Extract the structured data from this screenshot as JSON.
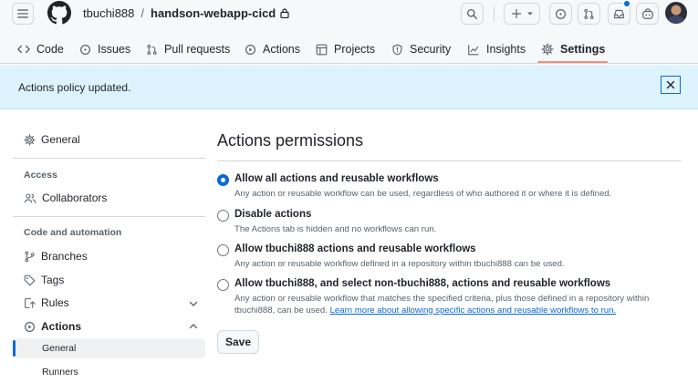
{
  "header": {
    "owner": "tbuchi888",
    "separator": "/",
    "repo": "handson-webapp-cicd",
    "icons": [
      "hamburger-icon",
      "github-logo-icon",
      "lock-icon",
      "search-icon",
      "plus-icon",
      "issue-icon",
      "pull-request-icon",
      "inbox-icon",
      "copilot-icon"
    ],
    "notification_color": "#0969da"
  },
  "tabs": [
    {
      "label": "Code",
      "icon": "code-icon"
    },
    {
      "label": "Issues",
      "icon": "issue-opened-icon"
    },
    {
      "label": "Pull requests",
      "icon": "git-pull-request-icon"
    },
    {
      "label": "Actions",
      "icon": "play-icon"
    },
    {
      "label": "Projects",
      "icon": "table-icon"
    },
    {
      "label": "Security",
      "icon": "shield-icon"
    },
    {
      "label": "Insights",
      "icon": "graph-icon"
    },
    {
      "label": "Settings",
      "icon": "gear-icon",
      "selected": true
    }
  ],
  "flash": {
    "message": "Actions policy updated."
  },
  "sidebar": {
    "general": "General",
    "access_heading": "Access",
    "collaborators": "Collaborators",
    "code_heading": "Code and automation",
    "branches": "Branches",
    "tags": "Tags",
    "rules": "Rules",
    "actions": "Actions",
    "actions_general": "General",
    "actions_runners": "Runners"
  },
  "main": {
    "title": "Actions permissions",
    "options": [
      {
        "label": "Allow all actions and reusable workflows",
        "description": "Any action or reusable workflow can be used, regardless of who authored it or where it is defined.",
        "checked": true
      },
      {
        "label": "Disable actions",
        "description": "The Actions tab is hidden and no workflows can run.",
        "checked": false
      },
      {
        "label": "Allow tbuchi888 actions and reusable workflows",
        "description": "Any action or reusable workflow defined in a repository within tbuchi888 can be used.",
        "checked": false
      },
      {
        "label": "Allow tbuchi888, and select non-tbuchi888, actions and reusable workflows",
        "description": "Any action or reusable workflow that matches the specified criteria, plus those defined in a repository within tbuchi888, can be used.",
        "link": "Learn more about allowing specific actions and reusable workflows to run.",
        "checked": false
      }
    ],
    "save_label": "Save"
  },
  "colors": {
    "accent": "#0969da",
    "flash_bg": "#ddf4ff",
    "tab_underline": "#fd8c73"
  }
}
